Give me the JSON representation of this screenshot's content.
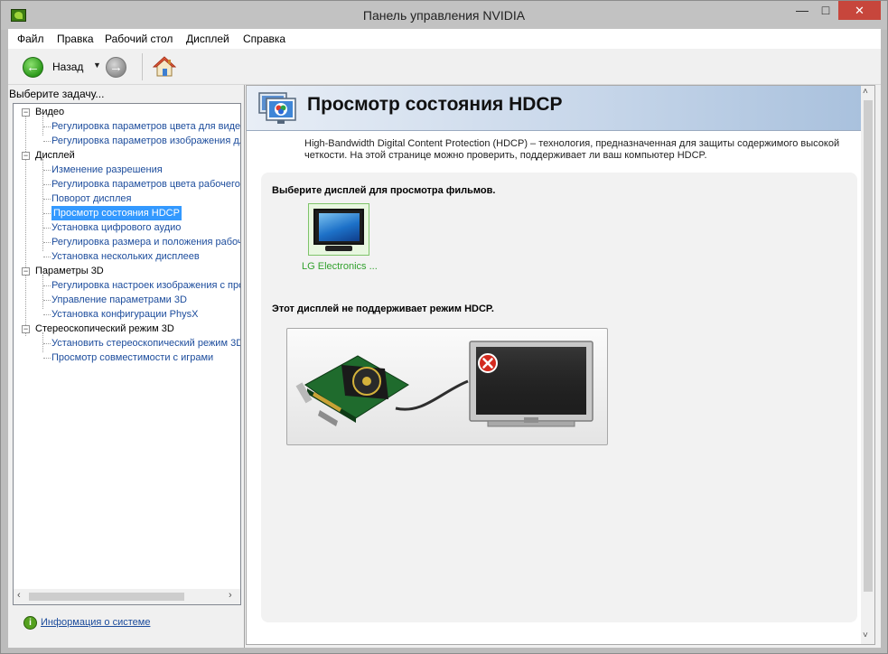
{
  "window": {
    "title": "Панель управления NVIDIA",
    "controls": {
      "minimize": "—",
      "maximize": "□",
      "close": "✕"
    }
  },
  "menu": [
    "Файл",
    "Правка",
    "Рабочий стол",
    "Дисплей",
    "Справка"
  ],
  "toolbar": {
    "back_label": "Назад",
    "back_icon": "arrow-left-icon",
    "forward_icon": "arrow-right-icon",
    "home_icon": "home-icon"
  },
  "sidebar": {
    "task_label": "Выберите задачу...",
    "categories": [
      {
        "label": "Видео",
        "items": [
          "Регулировка параметров цвета для видео",
          "Регулировка параметров изображения для видео"
        ]
      },
      {
        "label": "Дисплей",
        "items": [
          "Изменение разрешения",
          "Регулировка параметров цвета рабочего стола",
          "Поворот дисплея",
          "Просмотр состояния HDCP",
          "Установка цифрового аудио",
          "Регулировка размера и положения рабочего стола",
          "Установка нескольких дисплеев"
        ]
      },
      {
        "label": "Параметры 3D",
        "items": [
          "Регулировка настроек изображения с просмотром",
          "Управление параметрами 3D",
          "Установка конфигурации PhysX"
        ]
      },
      {
        "label": "Стереоскопический режим 3D",
        "items": [
          "Установить стереоскопический режим 3D",
          "Просмотр совместимости с играми"
        ]
      }
    ],
    "selected_item": "Просмотр состояния HDCP",
    "system_info_link": "Информация о системе"
  },
  "page": {
    "title": "Просмотр состояния HDCP",
    "description": "High-Bandwidth Digital Content Protection (HDCP) – технология, предназначенная для защиты содержимого высокой четкости. На этой странице можно проверить, поддерживает ли ваш компьютер HDCP.",
    "select_display_label": "Выберите дисплей для просмотра фильмов.",
    "display_name": "LG Electronics ...",
    "status_label": "Этот дисплей не поддерживает режим HDCP.",
    "status_icon": "error-x-icon"
  },
  "colors": {
    "accent_link": "#1c4c9c",
    "selection": "#3399ff",
    "display_green": "#32a12e",
    "close_red": "#c7463c",
    "error_red": "#d32a1e"
  }
}
